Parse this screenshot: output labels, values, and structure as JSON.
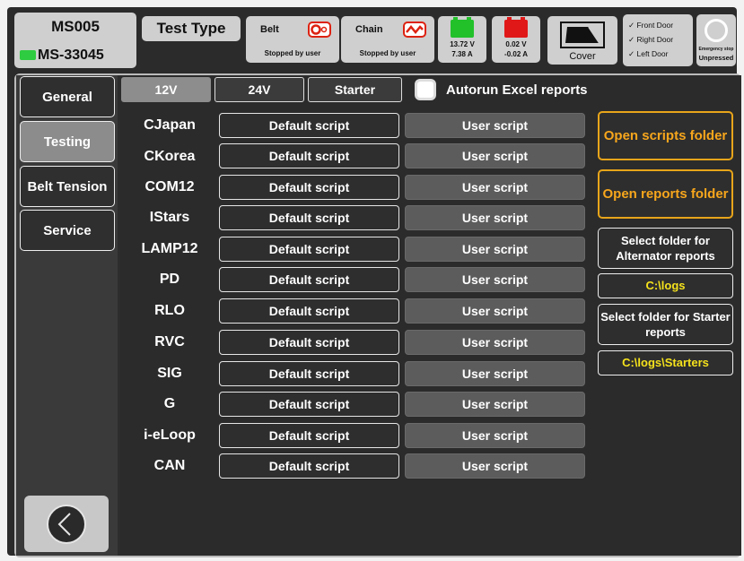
{
  "header": {
    "model": "MS005",
    "serial": "MS-33045",
    "test_type_label": "Test Type",
    "belt": {
      "name": "Belt",
      "status": "Stopped by user"
    },
    "chain": {
      "name": "Chain",
      "status": "Stopped by user"
    },
    "battery1": {
      "voltage": "13.72 V",
      "current": "7.38 A",
      "color": "#22c12a"
    },
    "battery2": {
      "voltage": "0.02 V",
      "current": "-0.02 A",
      "color": "#e01818"
    },
    "cover_label": "Cover",
    "doors": [
      "✓ Front Door",
      "✓ Right Door",
      "✓ Left Door"
    ],
    "estop": {
      "title": "Emergency stop",
      "state": "Unpressed"
    }
  },
  "sidebar": {
    "items": [
      {
        "label": "General",
        "active": false
      },
      {
        "label": "Testing",
        "active": true
      },
      {
        "label": "Belt Tension",
        "active": false
      },
      {
        "label": "Service",
        "active": false
      }
    ],
    "back_icon": "chevron-left-icon"
  },
  "tabs": [
    {
      "label": "12V",
      "active": true
    },
    {
      "label": "24V",
      "active": false
    },
    {
      "label": "Starter",
      "active": false
    }
  ],
  "autorun_label": "Autorun Excel reports",
  "autorun_checked": false,
  "scripts": {
    "default_label": "Default script",
    "user_label": "User script",
    "names": [
      "CJapan",
      "CKorea",
      "COM12",
      "IStars",
      "LAMP12",
      "PD",
      "RLO",
      "RVC",
      "SIG",
      "G",
      "i-eLoop",
      "CAN"
    ]
  },
  "right_panel": {
    "open_scripts": "Open scripts folder",
    "open_reports": "Open reports folder",
    "select_alt": "Select folder for Alternator reports",
    "alt_path": "C:\\logs",
    "select_starter": "Select folder for Starter reports",
    "starter_path": "C:\\logs\\Starters"
  },
  "colors": {
    "accent_orange": "#f7a61c",
    "path_yellow": "#f5e21c",
    "led_green": "#2ecc40"
  }
}
